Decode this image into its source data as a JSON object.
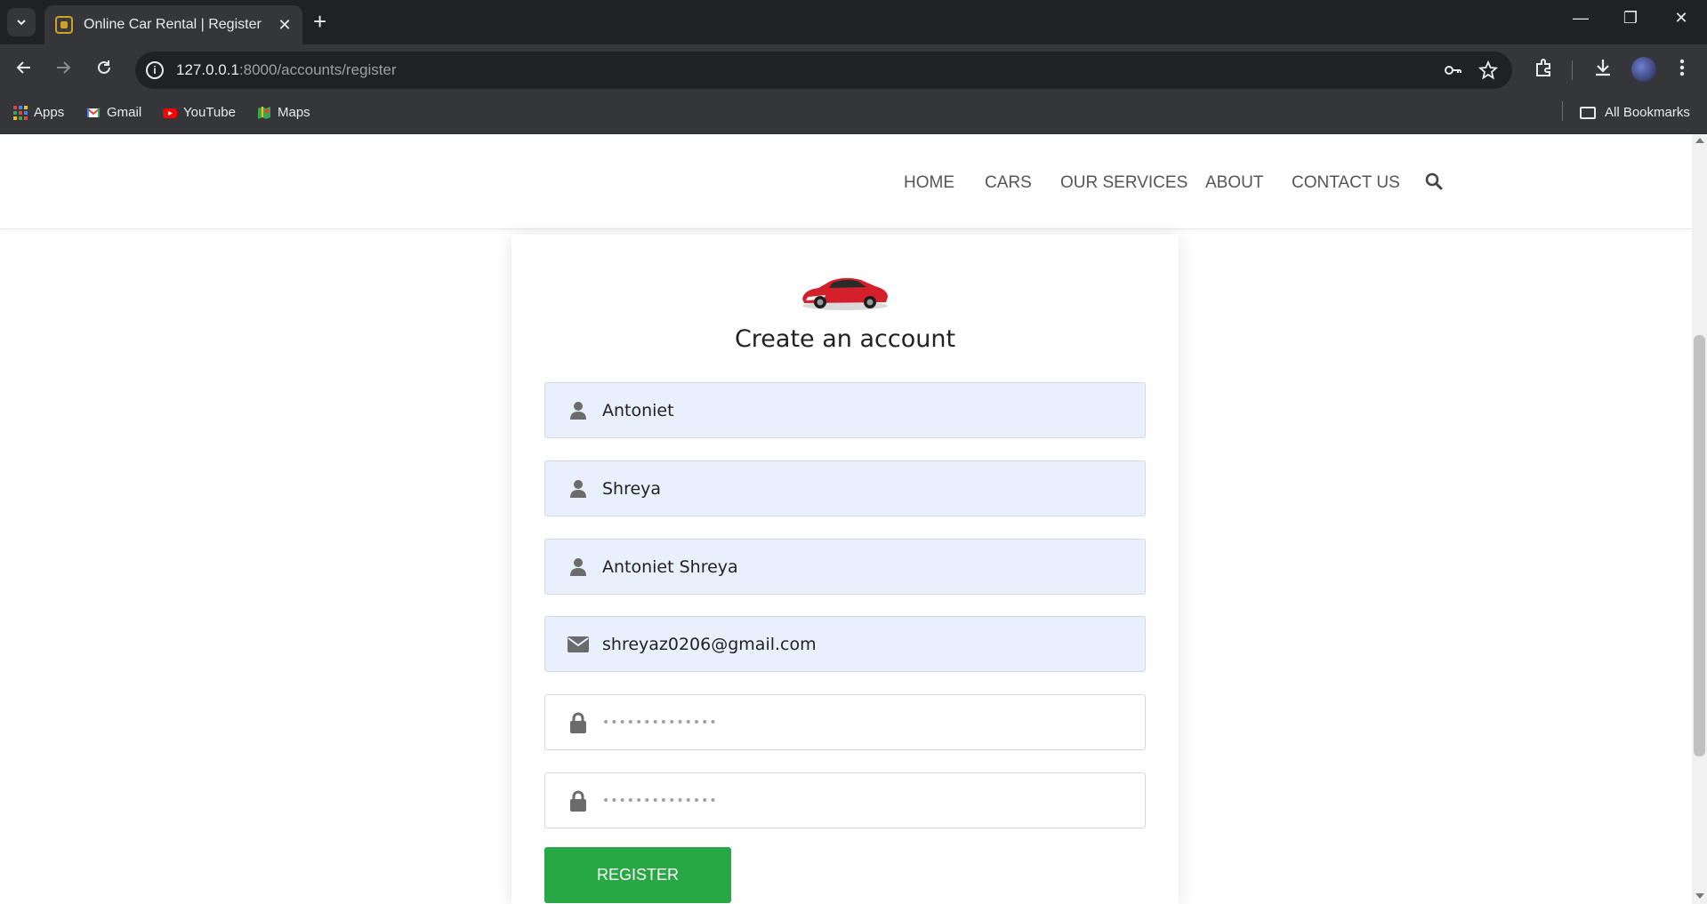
{
  "browser": {
    "tab_title": "Online Car Rental | Register",
    "url_host": "127.0.0.1",
    "url_path": ":8000/accounts/register",
    "bookmarks": [
      {
        "label": "Apps",
        "icon": "apps-grid-icon"
      },
      {
        "label": "Gmail",
        "icon": "gmail-icon"
      },
      {
        "label": "YouTube",
        "icon": "youtube-icon"
      },
      {
        "label": "Maps",
        "icon": "maps-icon"
      }
    ],
    "all_bookmarks_label": "All Bookmarks"
  },
  "site": {
    "nav": [
      "HOME",
      "CARS",
      "OUR SERVICES",
      "ABOUT",
      "CONTACT US"
    ],
    "search_icon": "search-icon"
  },
  "form": {
    "title": "Create an account",
    "fields": [
      {
        "name": "first-name",
        "icon": "user-icon",
        "value": "Antoniet"
      },
      {
        "name": "last-name",
        "icon": "user-icon",
        "value": "Shreya"
      },
      {
        "name": "username",
        "icon": "user-icon",
        "value": "Antoniet Shreya"
      },
      {
        "name": "email",
        "icon": "envelope-icon",
        "value": "shreyaz0206@gmail.com"
      },
      {
        "name": "password",
        "icon": "lock-icon",
        "value": "••••••••••••••"
      },
      {
        "name": "confirm-password",
        "icon": "lock-icon",
        "value": "••••••••••••••"
      }
    ],
    "submit_label": "REGISTER"
  },
  "colors": {
    "chrome_dark": "#202124",
    "chrome_toolbar": "#35363a",
    "autofill_bg": "#e8f0fe",
    "button_green": "#28a745",
    "nav_text": "#555555"
  }
}
